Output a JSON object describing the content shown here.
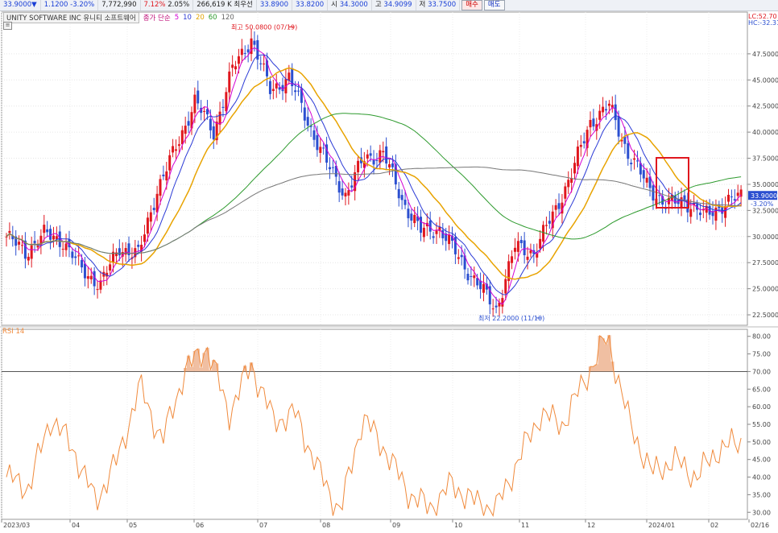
{
  "quote_bar": {
    "price": "33.9000",
    "arrow": "▼",
    "change": "1.1200",
    "change_pct": "-3.20%",
    "volume": "7,772,990",
    "pct2": "7.12%",
    "pct3": "2.05%",
    "turnover": "266,619 K",
    "prev_label": "최우선",
    "prev1": "33.8900",
    "prev2": "33.8200",
    "open_label": "시",
    "open": "34.3000",
    "high_label": "고",
    "high": "34.9099",
    "low_label": "저",
    "low": "33.7500",
    "buy_label": "매수",
    "sell_label": "매도"
  },
  "legend": {
    "title": "UNITY SOFTWARE INC  유니티 소프트웨어",
    "ma_label": "종가 단순",
    "ma5": "5",
    "ma10": "10",
    "ma20": "20",
    "ma60": "60",
    "ma120": "120"
  },
  "corner": {
    "lc": "LC:52.70",
    "hc": "HC:-32.31"
  },
  "annotations": {
    "high": "최고 50.0800 (07/19)",
    "low": "최저 22.2000 (11/10)",
    "last_price": "33.9000",
    "last_pct": "-3.20%"
  },
  "rsi_label": "RSI 14",
  "colors": {
    "up": "#e0171e",
    "down": "#2b4fd0",
    "ma5": "#d400d4",
    "ma10": "#2b3ad6",
    "ma20": "#e8a300",
    "ma60": "#2d9a2d",
    "ma120": "#777777",
    "rsi": "#f08a3c",
    "highlight_box": "#e0171e"
  },
  "chart_data": [
    {
      "type": "candlestick",
      "title": "UNITY SOFTWARE INC 유니티 소프트웨어",
      "ylim": [
        21.5,
        51.5
      ],
      "y_ticks": [
        "22.5000",
        "25.0000",
        "27.5000",
        "30.0000",
        "32.5000",
        "35.0000",
        "37.5000",
        "40.0000",
        "42.5000",
        "45.0000",
        "47.5000"
      ],
      "x_ticks": [
        "2023/03",
        "04",
        "05",
        "06",
        "07",
        "08",
        "09",
        "10",
        "11",
        "12",
        "2024/01",
        "02",
        "02/16"
      ],
      "close_anchors": [
        {
          "x": "2023/03",
          "close": 30.0
        },
        {
          "x": "03 mid",
          "close": 28.5
        },
        {
          "x": "04",
          "close": 30.2
        },
        {
          "x": "04 mid",
          "close": 29.6
        },
        {
          "x": "05",
          "close": 26.8
        },
        {
          "x": "05 mid",
          "close": 25.4
        },
        {
          "x": "05 late",
          "close": 29.0
        },
        {
          "x": "06",
          "close": 28.2
        },
        {
          "x": "06 early",
          "close": 34.5
        },
        {
          "x": "06 mid",
          "close": 38.5
        },
        {
          "x": "06 late",
          "close": 43.0
        },
        {
          "x": "07",
          "close": 40.0
        },
        {
          "x": "07 mid",
          "close": 46.0
        },
        {
          "x": "07/19",
          "close": 49.0
        },
        {
          "x": "07 late",
          "close": 44.0
        },
        {
          "x": "08",
          "close": 45.2
        },
        {
          "x": "08 early",
          "close": 41.0
        },
        {
          "x": "08 mid",
          "close": 37.0
        },
        {
          "x": "08 late",
          "close": 34.0
        },
        {
          "x": "09",
          "close": 37.5
        },
        {
          "x": "09 mid",
          "close": 38.0
        },
        {
          "x": "09 late",
          "close": 33.5
        },
        {
          "x": "10",
          "close": 30.5
        },
        {
          "x": "10 mid",
          "close": 30.8
        },
        {
          "x": "10 late",
          "close": 28.0
        },
        {
          "x": "11",
          "close": 25.5
        },
        {
          "x": "11/10",
          "close": 23.0
        },
        {
          "x": "11 mid",
          "close": 29.0
        },
        {
          "x": "11 late",
          "close": 28.5
        },
        {
          "x": "12",
          "close": 32.0
        },
        {
          "x": "12 mid",
          "close": 36.0
        },
        {
          "x": "12 late",
          "close": 41.0
        },
        {
          "x": "12/29",
          "close": 42.5
        },
        {
          "x": "2024/01",
          "close": 38.0
        },
        {
          "x": "01 early",
          "close": 35.0
        },
        {
          "x": "01 mid",
          "close": 33.0
        },
        {
          "x": "01 late",
          "close": 33.5
        },
        {
          "x": "02",
          "close": 32.0
        },
        {
          "x": "02 mid",
          "close": 33.0
        },
        {
          "x": "02/16",
          "close": 33.9
        }
      ],
      "extremes": {
        "high": 50.08,
        "high_date": "07/19",
        "low": 22.2,
        "low_date": "11/10"
      },
      "moving_averages": [
        "5",
        "10",
        "20",
        "60",
        "120"
      ],
      "last_price": 33.9
    },
    {
      "type": "line",
      "title": "RSI 14",
      "ylim": [
        28,
        82
      ],
      "y_ticks": [
        "30.00",
        "35.00",
        "40.00",
        "45.00",
        "50.00",
        "55.00",
        "60.00",
        "65.00",
        "70.00",
        "75.00",
        "80.00"
      ],
      "reference_line": 70,
      "values_anchors": [
        {
          "x": "2023/03",
          "y": 40
        },
        {
          "x": "03 mid",
          "y": 37
        },
        {
          "x": "04",
          "y": 57
        },
        {
          "x": "04 mid",
          "y": 48
        },
        {
          "x": "05",
          "y": 33
        },
        {
          "x": "05 mid",
          "y": 45
        },
        {
          "x": "05 late",
          "y": 66
        },
        {
          "x": "06",
          "y": 50
        },
        {
          "x": "06 mid",
          "y": 70
        },
        {
          "x": "06 late",
          "y": 77
        },
        {
          "x": "07",
          "y": 58
        },
        {
          "x": "07 mid",
          "y": 72
        },
        {
          "x": "07 late",
          "y": 56
        },
        {
          "x": "08",
          "y": 58
        },
        {
          "x": "08 mid",
          "y": 42
        },
        {
          "x": "08 late",
          "y": 30
        },
        {
          "x": "09",
          "y": 57
        },
        {
          "x": "09 mid",
          "y": 48
        },
        {
          "x": "09 late",
          "y": 36
        },
        {
          "x": "10",
          "y": 31
        },
        {
          "x": "10 mid",
          "y": 38
        },
        {
          "x": "10 late",
          "y": 33
        },
        {
          "x": "11",
          "y": 31
        },
        {
          "x": "11 mid",
          "y": 45
        },
        {
          "x": "11 late",
          "y": 58
        },
        {
          "x": "12",
          "y": 55
        },
        {
          "x": "12 mid",
          "y": 68
        },
        {
          "x": "12 late",
          "y": 80
        },
        {
          "x": "2024/01",
          "y": 55
        },
        {
          "x": "01 mid",
          "y": 41
        },
        {
          "x": "01 late",
          "y": 45
        },
        {
          "x": "02",
          "y": 40
        },
        {
          "x": "02 mid",
          "y": 48
        },
        {
          "x": "02/16",
          "y": 50
        }
      ]
    }
  ]
}
